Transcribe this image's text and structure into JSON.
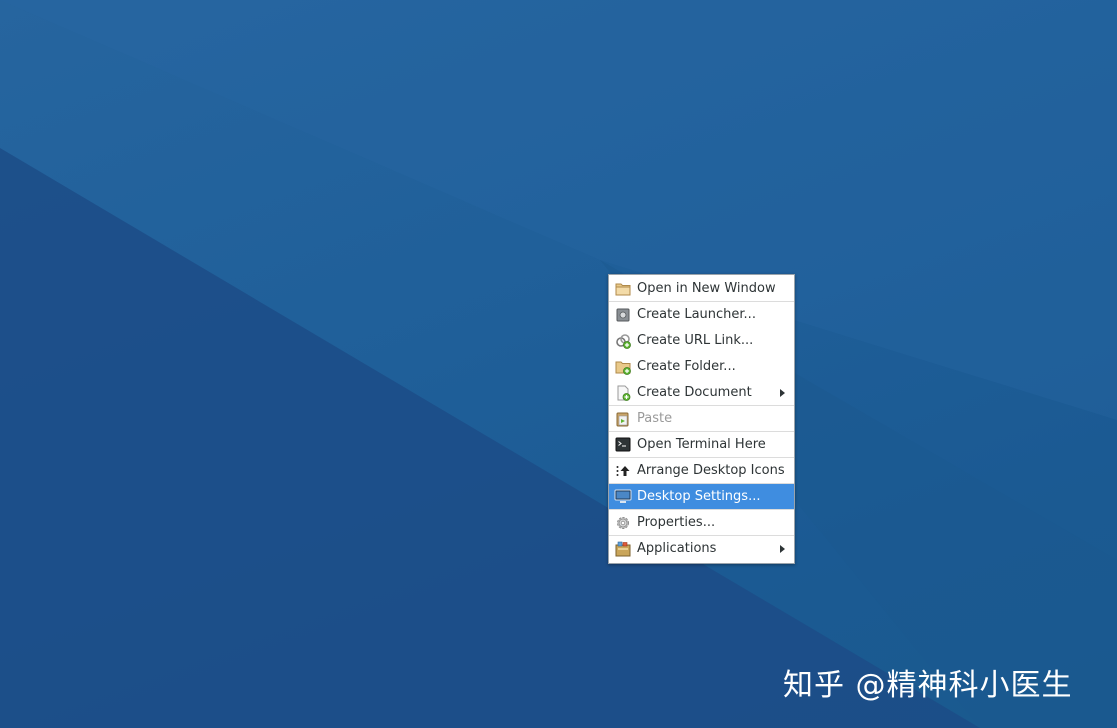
{
  "desktop": {
    "colors": {
      "background": "#1f5f99",
      "menu_highlight": "#3f8de0"
    }
  },
  "context_menu": {
    "items": [
      {
        "label": "Open in New Window",
        "icon": "folder-icon"
      },
      {
        "label": "Create Launcher...",
        "icon": "launcher-icon"
      },
      {
        "label": "Create URL Link...",
        "icon": "url-link-icon"
      },
      {
        "label": "Create Folder...",
        "icon": "new-folder-icon"
      },
      {
        "label": "Create Document",
        "icon": "new-document-icon",
        "submenu": true
      },
      {
        "label": "Paste",
        "icon": "paste-icon",
        "disabled": true
      },
      {
        "label": "Open Terminal Here",
        "icon": "terminal-icon"
      },
      {
        "label": "Arrange Desktop Icons",
        "icon": "arrange-icon"
      },
      {
        "label": "Desktop Settings...",
        "icon": "monitor-icon",
        "highlighted": true
      },
      {
        "label": "Properties...",
        "icon": "gear-icon"
      },
      {
        "label": "Applications",
        "icon": "applications-icon",
        "submenu": true
      }
    ]
  },
  "watermark": {
    "text": "知乎 @精神科小医生"
  }
}
